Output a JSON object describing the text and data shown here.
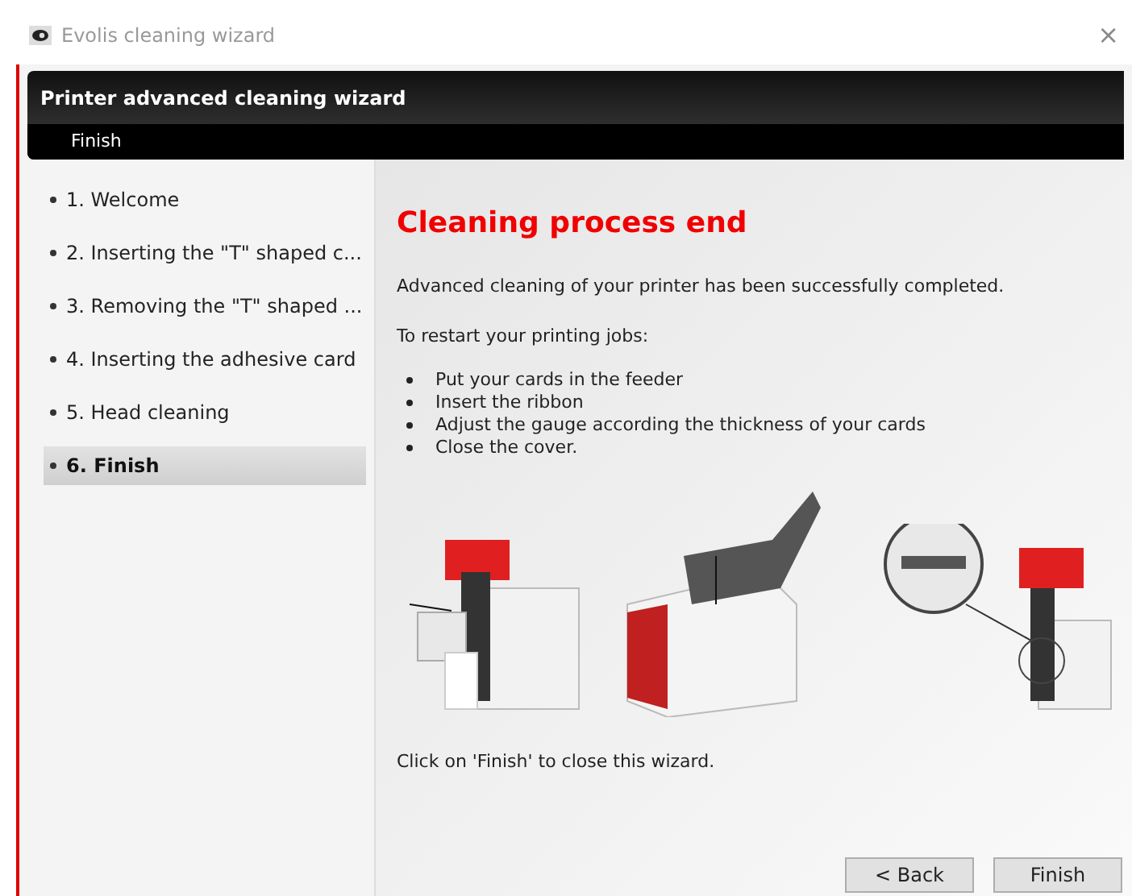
{
  "window": {
    "title": "Evolis cleaning wizard",
    "close": "×"
  },
  "header": {
    "title": "Printer advanced cleaning wizard",
    "subtitle": "Finish"
  },
  "steps": [
    {
      "label": "1. Welcome",
      "selected": false
    },
    {
      "label": "2. Inserting the \"T\" shaped c...",
      "selected": false
    },
    {
      "label": "3. Removing the \"T\" shaped ...",
      "selected": false
    },
    {
      "label": "4. Inserting the adhesive card",
      "selected": false
    },
    {
      "label": "5. Head cleaning",
      "selected": false
    },
    {
      "label": "6. Finish",
      "selected": true
    }
  ],
  "content": {
    "heading": "Cleaning process end",
    "message": "Advanced cleaning of your printer has been successfully completed.",
    "intro": "To restart your printing jobs:",
    "bullets": [
      "Put your cards in the feeder",
      "Insert the ribbon",
      "Adjust the gauge according the thickness of your cards",
      "Close the cover."
    ],
    "footer": "Click on 'Finish' to close this wizard."
  },
  "buttons": [
    "< Back",
    "Finish"
  ]
}
